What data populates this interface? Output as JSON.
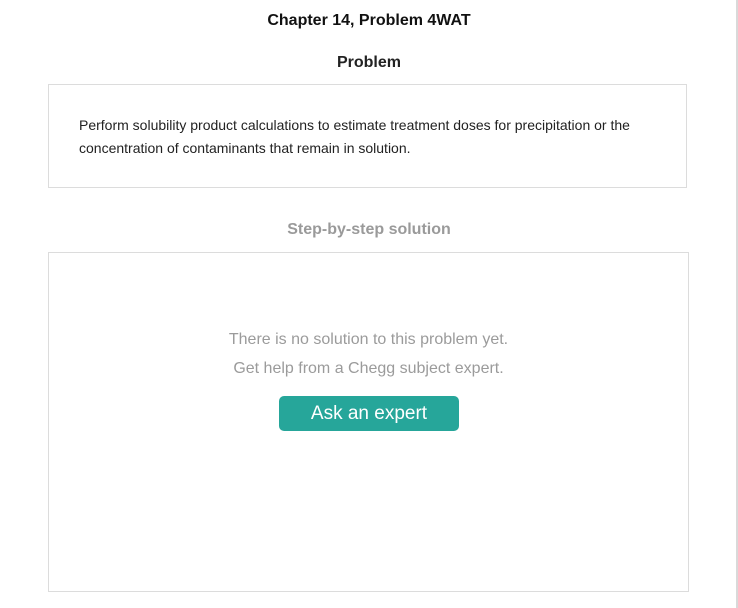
{
  "header": {
    "title": "Chapter 14, Problem 4WAT"
  },
  "problem": {
    "heading": "Problem",
    "text": "Perform solubility product calculations to estimate treatment doses for precipitation or the concentration of contaminants that remain in solution."
  },
  "solution": {
    "heading": "Step-by-step solution",
    "empty_line_1": "There is no solution to this problem yet.",
    "empty_line_2": "Get help from a Chegg subject expert.",
    "button_label": "Ask an expert",
    "button_color": "#26a69a"
  }
}
